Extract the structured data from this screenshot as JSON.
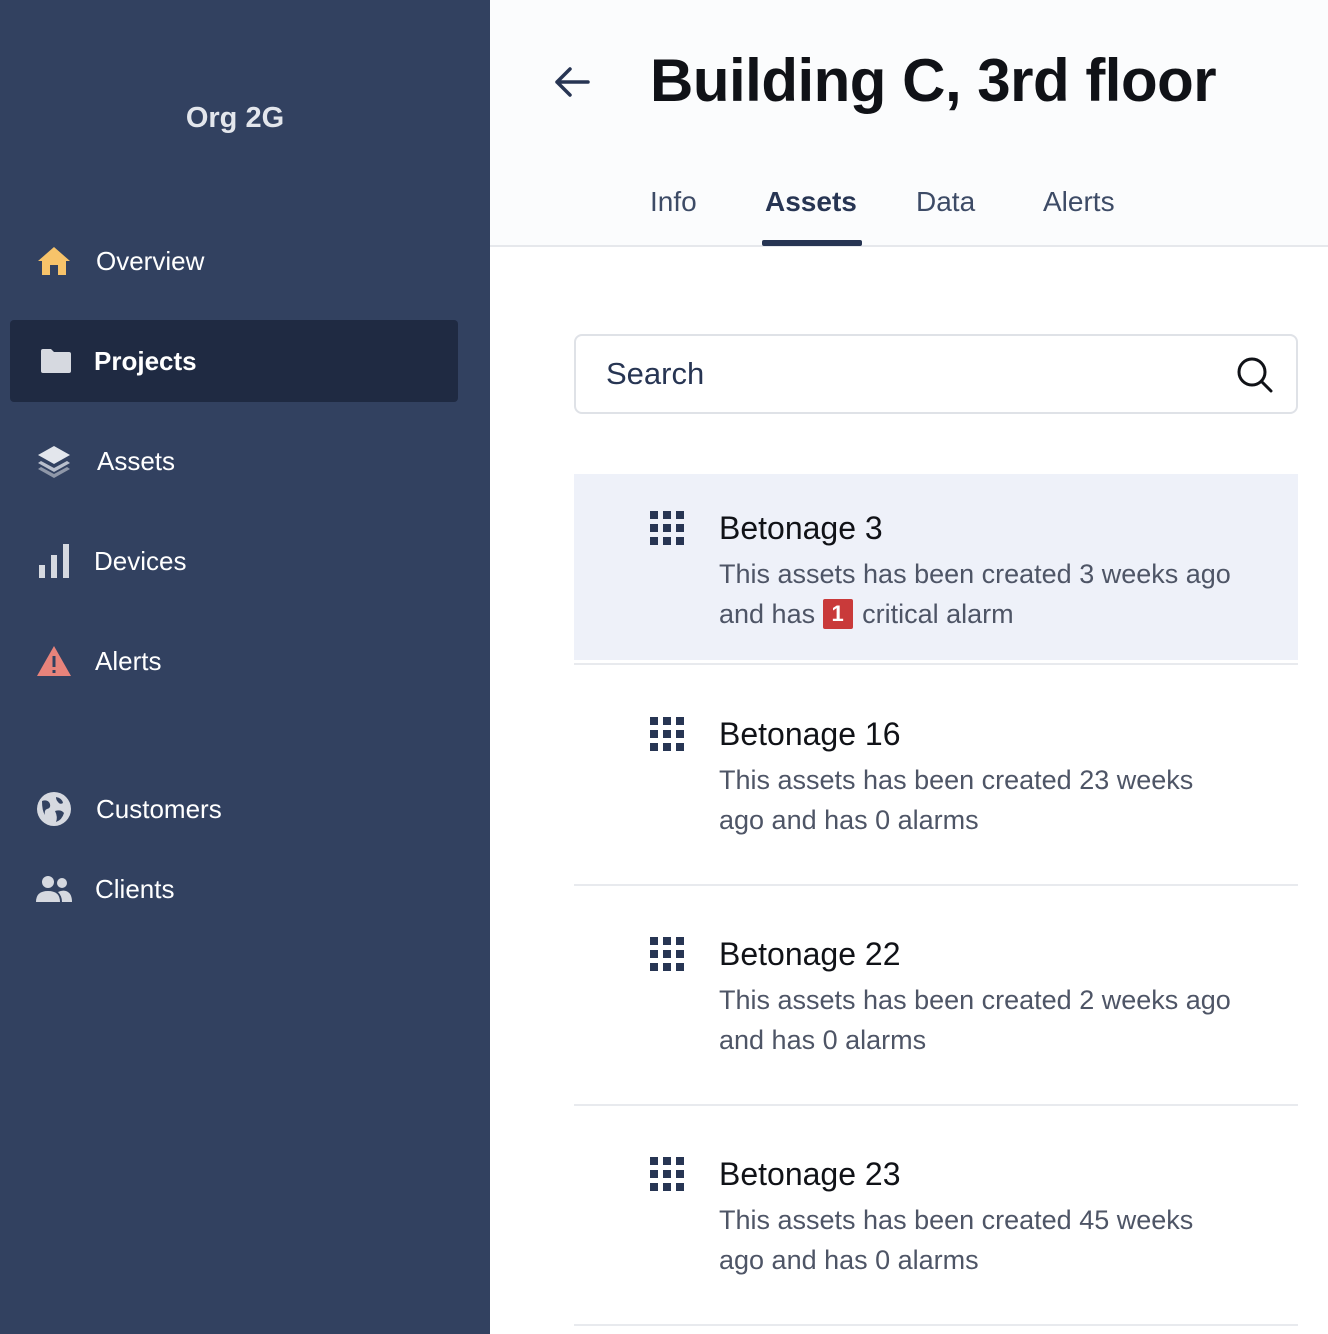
{
  "sidebar": {
    "org_name": "Org 2G",
    "items": [
      {
        "label": "Overview",
        "icon": "home-icon",
        "color": "#f7c36a"
      },
      {
        "label": "Projects",
        "icon": "folder-icon",
        "active": true
      },
      {
        "label": "Assets",
        "icon": "layers-icon"
      },
      {
        "label": "Devices",
        "icon": "bar-chart-icon"
      },
      {
        "label": "Alerts",
        "icon": "warning-icon",
        "color": "#e8837b"
      },
      {
        "label": "Customers",
        "icon": "globe-icon"
      },
      {
        "label": "Clients",
        "icon": "users-icon"
      }
    ]
  },
  "header": {
    "back_icon": "arrow-left-icon",
    "title": "Building C, 3rd floor",
    "tabs": [
      {
        "label": "Info"
      },
      {
        "label": "Assets",
        "active": true
      },
      {
        "label": "Data"
      },
      {
        "label": "Alerts"
      }
    ]
  },
  "search": {
    "placeholder": "Search",
    "icon": "search-icon"
  },
  "assets": [
    {
      "name": "Betonage 3",
      "desc_before": "This assets has been created 3 weeks ago and has",
      "badge": "1",
      "desc_after": "critical alarm",
      "highlight": true
    },
    {
      "name": "Betonage 16",
      "desc": "This assets has been created 23 weeks ago and has 0 alarms"
    },
    {
      "name": "Betonage 22",
      "desc": "This assets has been created 2 weeks ago and has 0 alarms"
    },
    {
      "name": "Betonage 23",
      "desc": "This assets has been created 45 weeks ago and has 0 alarms"
    }
  ],
  "colors": {
    "sidebar_bg": "#324160",
    "active_bg": "#1f2a42",
    "accent": "#273553",
    "badge": "#c93a3a",
    "highlight_row": "#eef1f9"
  }
}
